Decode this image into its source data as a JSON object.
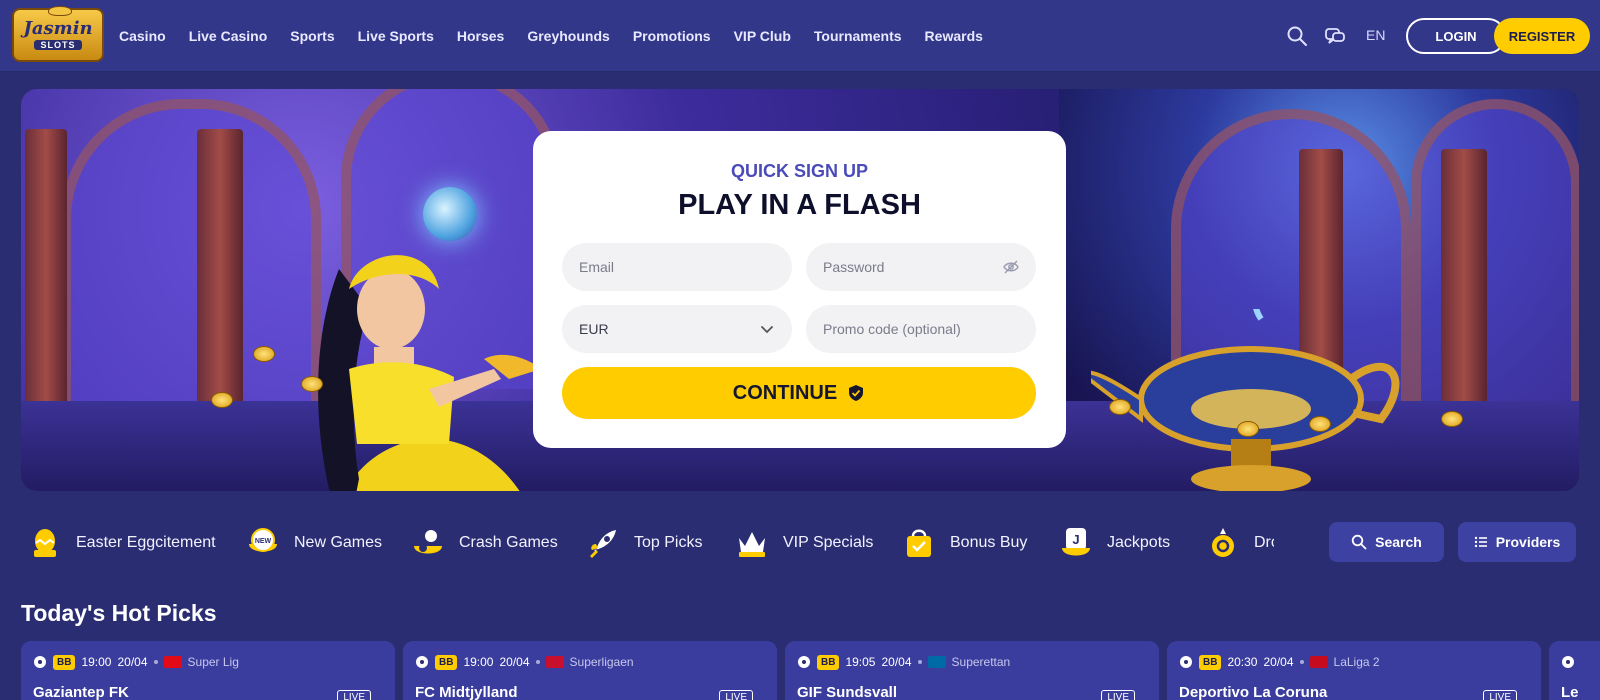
{
  "brand": {
    "logo_line1": "Jasmin",
    "logo_line2": "SLOTS"
  },
  "nav": [
    "Casino",
    "Live Casino",
    "Sports",
    "Live Sports",
    "Horses",
    "Greyhounds",
    "Promotions",
    "VIP Club",
    "Tournaments",
    "Rewards"
  ],
  "header": {
    "language": "EN",
    "login_label": "LOGIN",
    "register_label": "REGISTER",
    "icons": [
      "search-icon",
      "chat-icon"
    ]
  },
  "signup": {
    "eyebrow": "QUICK SIGN UP",
    "title": "PLAY IN A FLASH",
    "email_placeholder": "Email",
    "password_placeholder": "Password",
    "currency_value": "EUR",
    "promo_placeholder": "Promo code (optional)",
    "continue_label": "CONTINUE"
  },
  "categories": [
    {
      "label": "Easter Eggcitement",
      "icon": "easter-egg-icon"
    },
    {
      "label": "New Games",
      "icon": "new-badge-icon"
    },
    {
      "label": "Crash Games",
      "icon": "crash-icon"
    },
    {
      "label": "Top Picks",
      "icon": "rocket-icon"
    },
    {
      "label": "VIP Specials",
      "icon": "crown-icon"
    },
    {
      "label": "Bonus Buy",
      "icon": "shopping-bag-icon"
    },
    {
      "label": "Jackpots",
      "icon": "jackpot-icon"
    },
    {
      "label": "Dro",
      "icon": "drops-icon"
    }
  ],
  "tools": {
    "search_label": "Search",
    "providers_label": "Providers"
  },
  "hot_picks": {
    "title": "Today's Hot Picks",
    "badge": "BB",
    "live_label": "LIVE",
    "matches": [
      {
        "time": "19:00",
        "date": "20/04",
        "league": "Super Lig",
        "team": "Gaziantep FK",
        "flag_color": "#e30a17"
      },
      {
        "time": "19:00",
        "date": "20/04",
        "league": "Superligaen",
        "team": "FC Midtjylland",
        "flag_color": "#c8102e"
      },
      {
        "time": "19:05",
        "date": "20/04",
        "league": "Superettan",
        "team": "GIF Sundsvall",
        "flag_color": "#006aa7"
      },
      {
        "time": "20:30",
        "date": "20/04",
        "league": "LaLiga 2",
        "team": "Deportivo La Coruna",
        "flag_color": "#c60b1e"
      },
      {
        "team": "Le"
      }
    ]
  },
  "colors": {
    "accent": "#ffcc00",
    "header_bg": "#33378a",
    "page_bg": "#2a2d72",
    "card_title": "#4a4bb8"
  }
}
